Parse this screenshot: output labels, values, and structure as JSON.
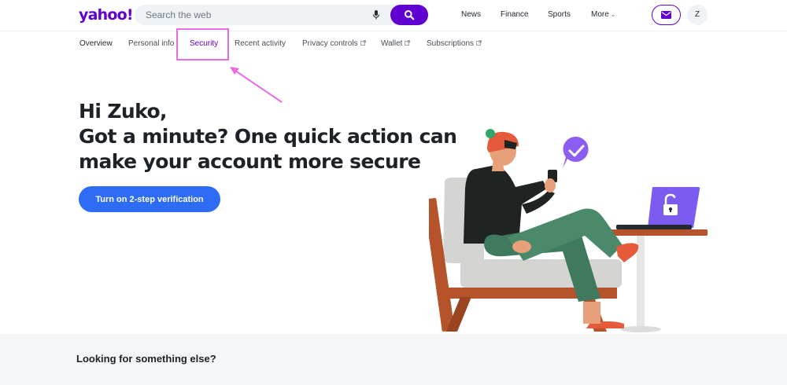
{
  "header": {
    "logo_text": "yahoo!",
    "search": {
      "placeholder": "Search the web",
      "value": ""
    },
    "nav": [
      {
        "label": "News"
      },
      {
        "label": "Finance"
      },
      {
        "label": "Sports"
      },
      {
        "label": "More"
      }
    ],
    "avatar_initial": "Z"
  },
  "tabs": [
    {
      "label": "Overview",
      "external": false
    },
    {
      "label": "Personal info",
      "external": false
    },
    {
      "label": "Security",
      "external": false,
      "active": true
    },
    {
      "label": "Recent activity",
      "external": false
    },
    {
      "label": "Privacy controls",
      "external": true
    },
    {
      "label": "Wallet",
      "external": true
    },
    {
      "label": "Subscriptions",
      "external": true
    }
  ],
  "hero": {
    "greeting": "Hi Zuko,",
    "line1": "Got a minute? One quick action can",
    "line2": "make your account more secure",
    "cta_label": "Turn on 2-step verification"
  },
  "footer": {
    "title": "Looking for something else?"
  },
  "colors": {
    "brand": "#6001d2",
    "cta": "#2f6cf5",
    "highlight": "#e86be6"
  },
  "icons": {
    "search": "magnifier-icon",
    "mic": "microphone-icon",
    "mail": "envelope-icon",
    "external": "external-link-icon"
  }
}
